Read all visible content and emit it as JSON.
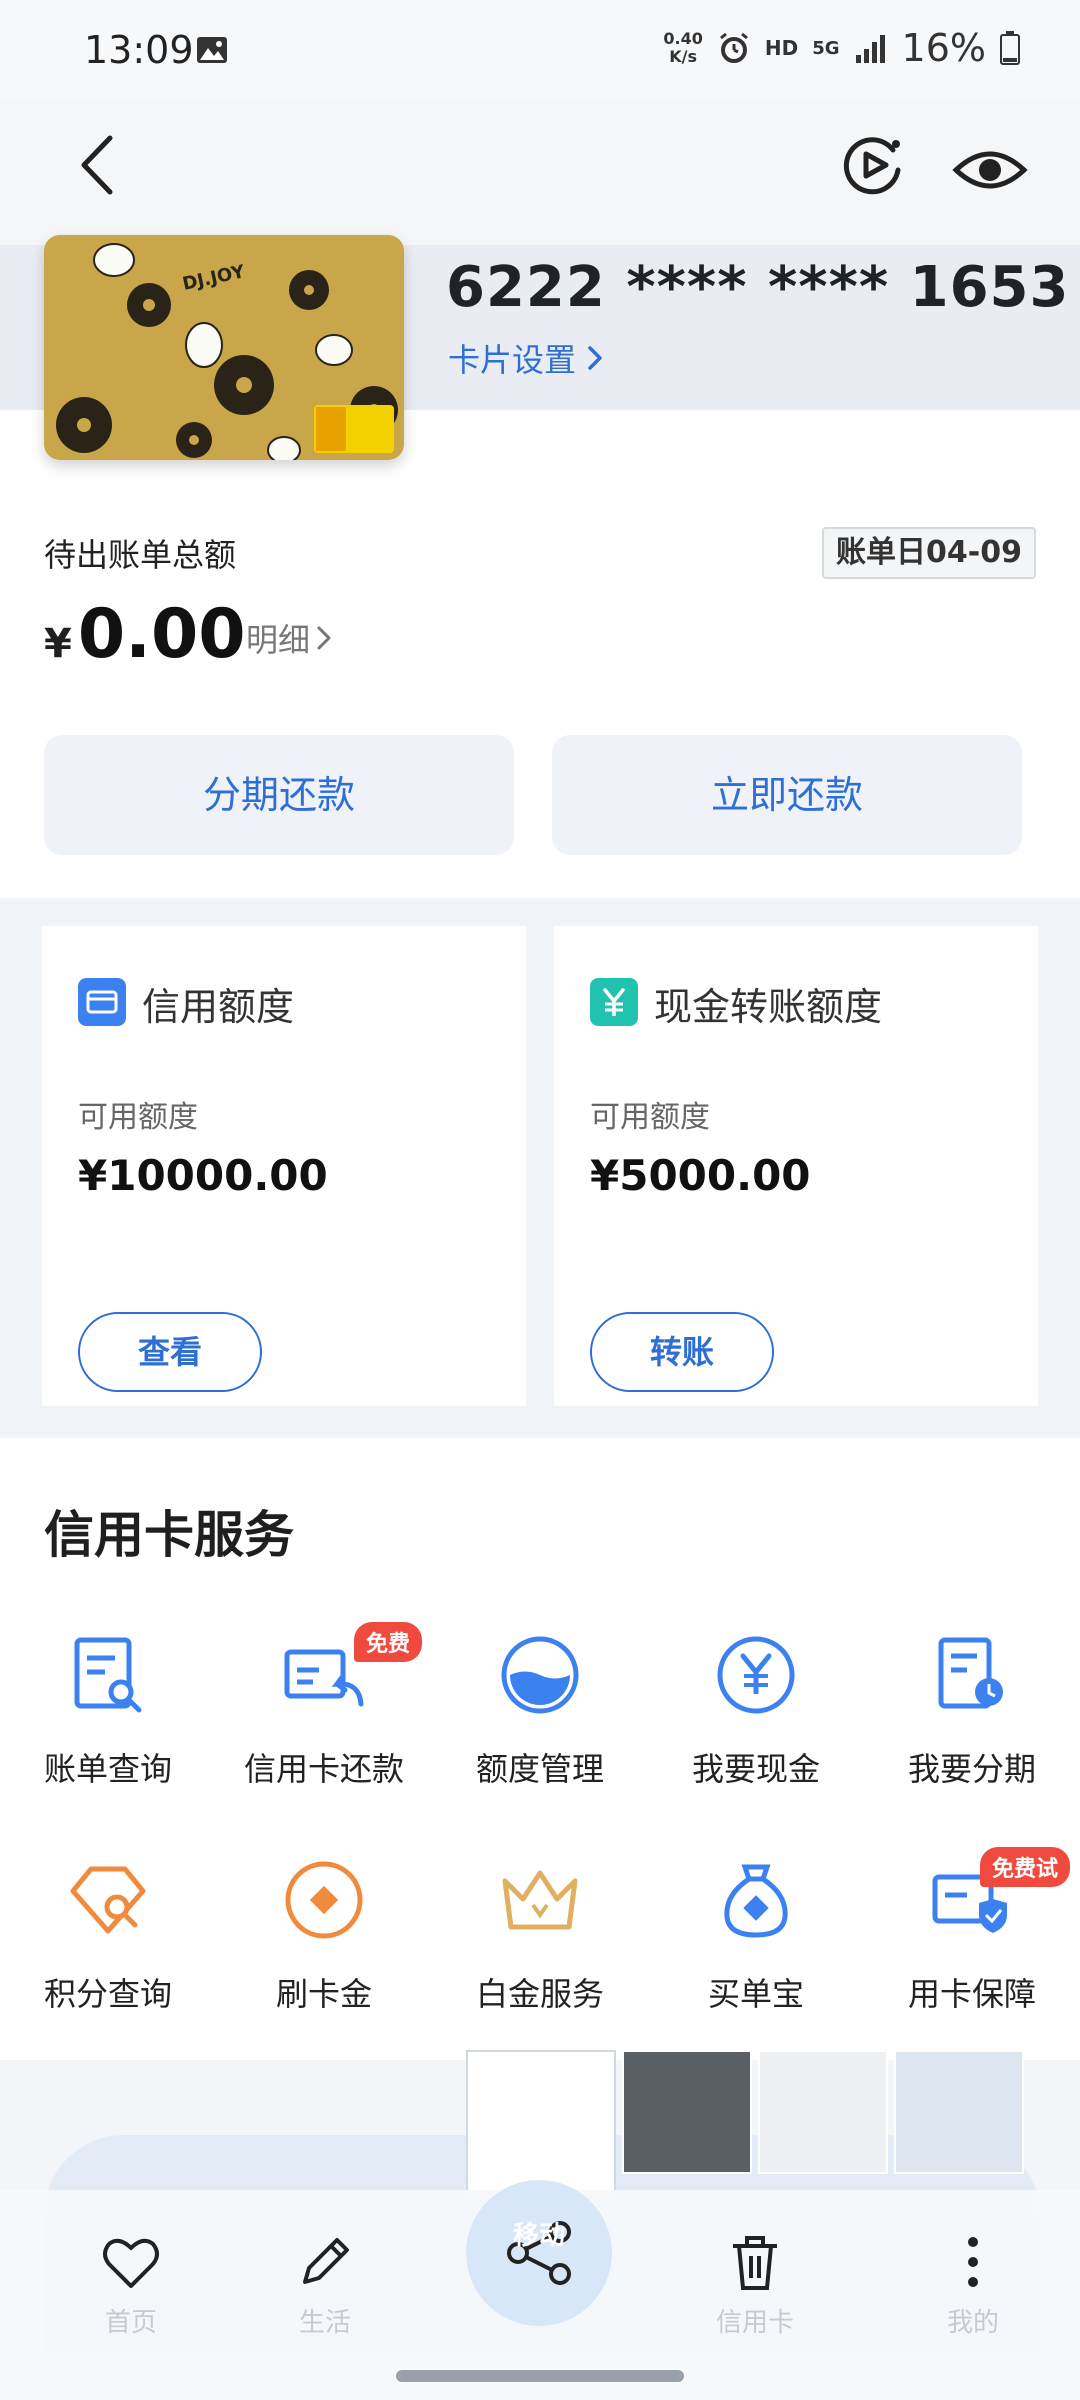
{
  "status_bar": {
    "time": "13:09",
    "net_speed_top": "0.40",
    "net_speed_unit": "K/s",
    "hd": "HD",
    "signal": "5G",
    "battery": "16%"
  },
  "card": {
    "number": "6222 **** **** 1653",
    "settings_label": "卡片设置",
    "art_text": "DJ.JOY"
  },
  "bill": {
    "pending_label": "待出账单总额",
    "bill_day": "账单日04-09",
    "currency_symbol": "¥",
    "amount": "0.00",
    "detail_link": "明细"
  },
  "repay": {
    "installment_label": "分期还款",
    "pay_now_label": "立即还款"
  },
  "limits": [
    {
      "title": "信用额度",
      "sub": "可用额度",
      "amount": "¥10000.00",
      "button": "查看"
    },
    {
      "title": "现金转账额度",
      "sub": "可用额度",
      "amount": "¥5000.00",
      "button": "转账"
    }
  ],
  "services": {
    "title": "信用卡服务",
    "items": [
      {
        "label": "账单查询",
        "icon": "bill-query-icon"
      },
      {
        "label": "信用卡还款",
        "icon": "card-repay-icon",
        "badge": "免费"
      },
      {
        "label": "额度管理",
        "icon": "limit-manage-icon"
      },
      {
        "label": "我要现金",
        "icon": "cash-icon"
      },
      {
        "label": "我要分期",
        "icon": "installment-icon"
      },
      {
        "label": "积分查询",
        "icon": "points-query-icon"
      },
      {
        "label": "刷卡金",
        "icon": "swipe-gold-icon"
      },
      {
        "label": "白金服务",
        "icon": "platinum-crown-icon"
      },
      {
        "label": "买单宝",
        "icon": "pay-bag-icon"
      },
      {
        "label": "用卡保障",
        "icon": "card-protect-icon",
        "badge": "免费试"
      }
    ]
  },
  "share_bar": {
    "share_label": "移动"
  },
  "bottom_nav": [
    {
      "label": "首页",
      "icon": "heart-icon"
    },
    {
      "label": "生活",
      "icon": "pencil-icon"
    },
    {
      "label": "信用卡",
      "icon": "trash-icon"
    },
    {
      "label": "我的",
      "icon": "more-vertical-icon"
    }
  ],
  "colors": {
    "accent": "#2f6fd3",
    "badge_red": "#f04a3e",
    "icon_orange": "#f08a3c",
    "section_bg": "#f0f3f8"
  }
}
